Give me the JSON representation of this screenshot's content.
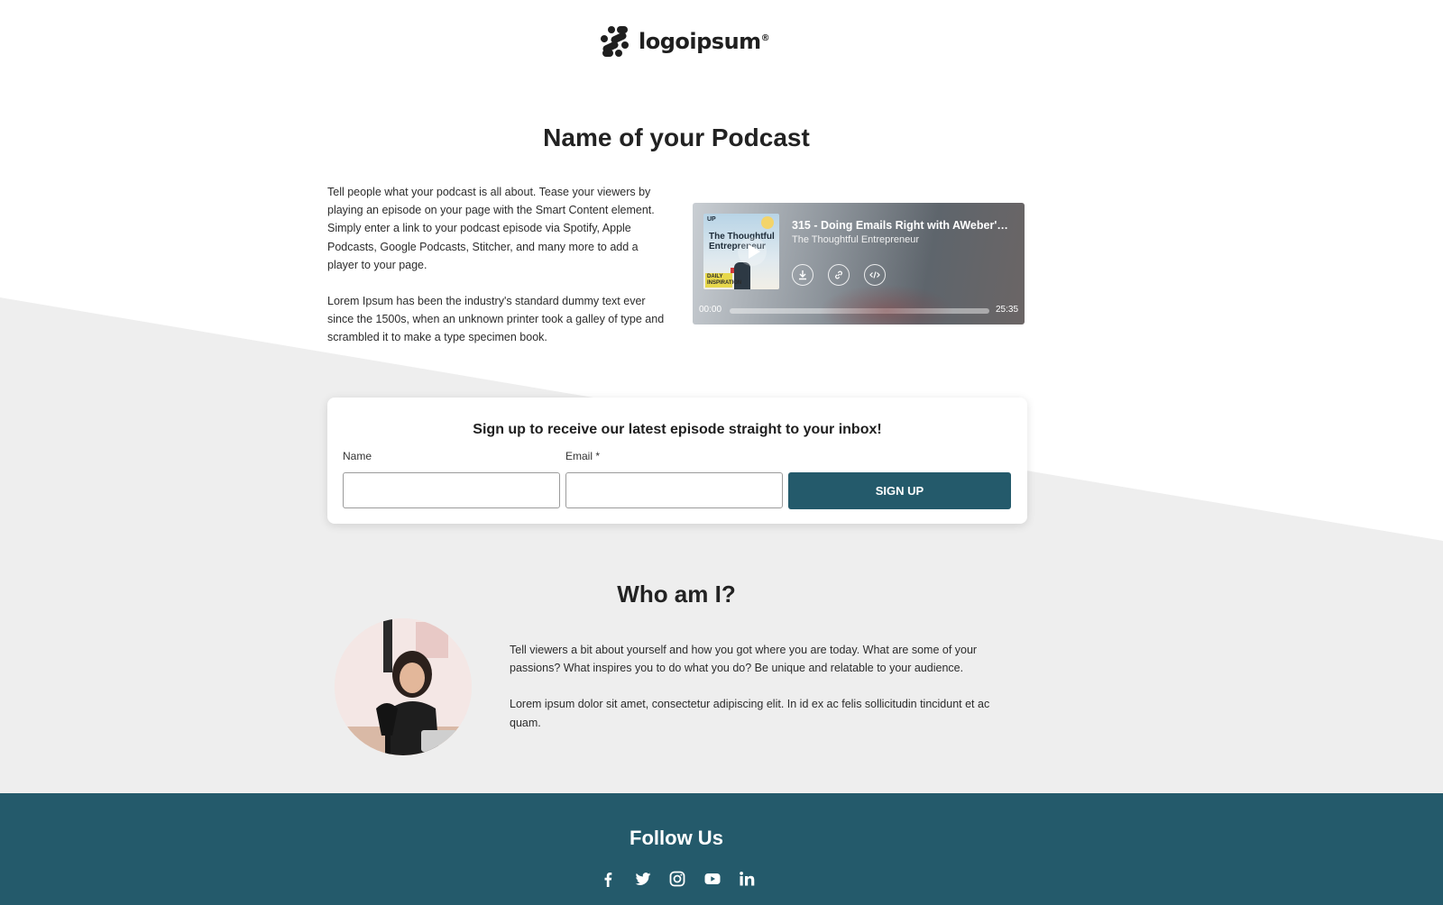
{
  "brand": {
    "name": "logoipsum",
    "mark": "®"
  },
  "hero": {
    "title": "Name of your Podcast"
  },
  "intro": {
    "paragraphs": [
      "Tell people what your podcast is all about. Tease your viewers by playing an episode on your page with the Smart Content element. Simply enter a link to your podcast episode via Spotify, Apple Podcasts, Google Podcasts, Stitcher, and many more to add a player to your page.",
      "Lorem Ipsum has been the industry's standard dummy text ever since the 1500s, when an unknown printer took a galley of type and scrambled it to make a type specimen book."
    ]
  },
  "player": {
    "episode_title": "315 - Doing Emails Right with AWeber's T...",
    "show_name": "The Thoughtful Entrepreneur",
    "cover": {
      "title": "The Thoughtful Entrepreneur",
      "badge": "UP",
      "tag": "DAILY INSPIRATION"
    },
    "time_current": "00:00",
    "time_total": "25:35",
    "progress": 0,
    "icons": [
      "play-icon",
      "download-icon",
      "link-icon",
      "embed-code-icon"
    ]
  },
  "signup": {
    "title": "Sign up to receive our latest episode straight to your inbox!",
    "name_label": "Name",
    "name_value": "",
    "email_label": "Email *",
    "email_value": "",
    "button_label": "SIGN UP"
  },
  "about": {
    "title": "Who am I?",
    "paragraphs": [
      "Tell viewers a bit about yourself and how you got where you are today. What are some of your passions? What inspires you to do what you do? Be unique and relatable to your audience.",
      "Lorem ipsum dolor sit amet, consectetur adipiscing elit. In id ex ac felis sollicitudin tincidunt et ac quam."
    ]
  },
  "footer": {
    "title": "Follow Us",
    "socials": [
      "facebook-icon",
      "twitter-icon",
      "instagram-icon",
      "youtube-icon",
      "linkedin-icon"
    ]
  },
  "colors": {
    "accent": "#245a6b",
    "background_band": "#eeeeee",
    "text": "#2b2b2b"
  }
}
